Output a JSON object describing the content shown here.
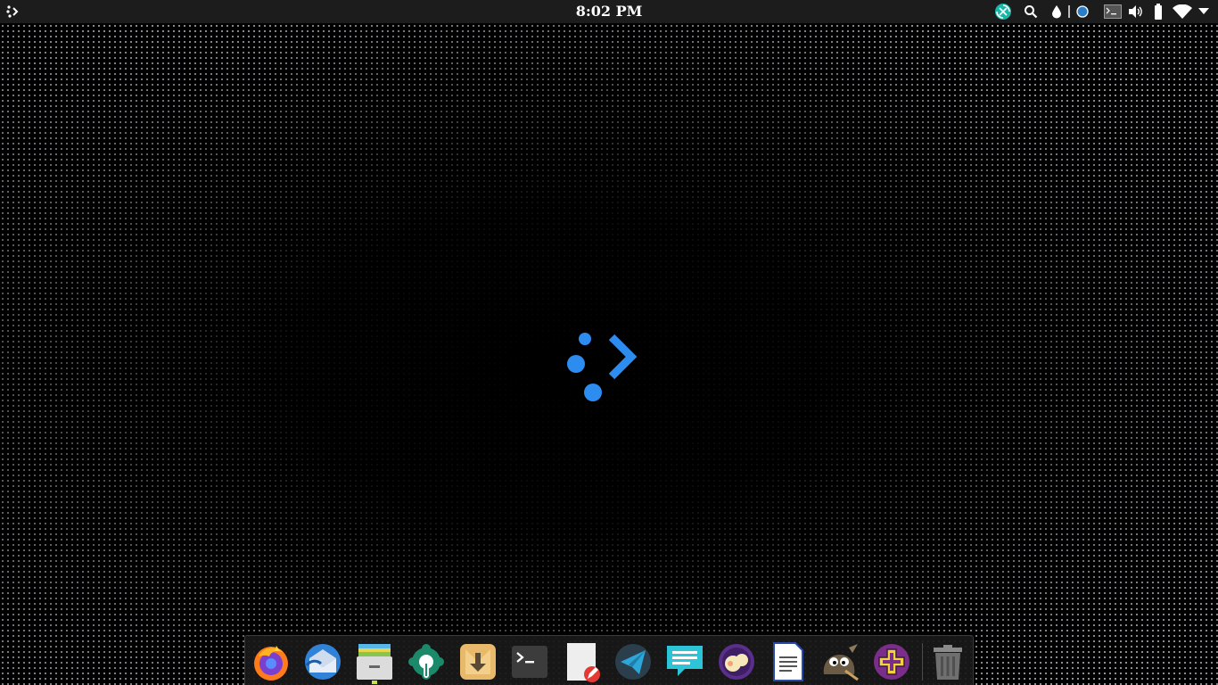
{
  "top_panel": {
    "apps_menu_icon": "apps-menu-icon",
    "clock": "8:02 PM",
    "tray": [
      "app-indicator-icon",
      "search-icon",
      "drop-icon",
      "record-icon",
      "terminal-icon",
      "volume-icon",
      "battery-icon",
      "wifi-icon",
      "system-menu-arrow-icon"
    ]
  },
  "desktop": {
    "center_logo_icon": "launcher-logo-icon",
    "accent_color": "#2d8cf0"
  },
  "dock": {
    "items": [
      "firefox-icon",
      "thunderbird-icon",
      "files-icon",
      "tweaks-icon",
      "installer-icon",
      "terminal-icon",
      "text-editor-icon",
      "telegram-icon",
      "messages-icon",
      "ao-icon",
      "document-viewer-icon",
      "gimp-icon",
      "add-apps-icon",
      "trash-icon"
    ],
    "running_item": "files-icon",
    "indicator_color": "#c8e04a"
  }
}
